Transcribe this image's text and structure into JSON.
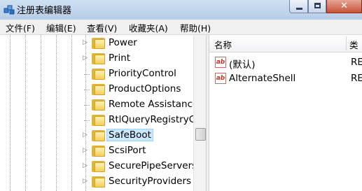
{
  "window": {
    "title": "注册表编辑器",
    "close_glyph": "✕"
  },
  "menu": [
    "文件(F)",
    "编辑(E)",
    "查看(V)",
    "收藏夹(A)",
    "帮助(H)"
  ],
  "tree": {
    "items": [
      {
        "label": "Power",
        "expandable": true,
        "selected": false
      },
      {
        "label": "Print",
        "expandable": true,
        "selected": false
      },
      {
        "label": "PriorityControl",
        "expandable": false,
        "selected": false
      },
      {
        "label": "ProductOptions",
        "expandable": false,
        "selected": false
      },
      {
        "label": "Remote Assistance",
        "expandable": false,
        "selected": false
      },
      {
        "label": "RtlQueryRegistryCo",
        "expandable": false,
        "selected": false
      },
      {
        "label": "SafeBoot",
        "expandable": true,
        "selected": true
      },
      {
        "label": "ScsiPort",
        "expandable": true,
        "selected": false
      },
      {
        "label": "SecurePipeServers",
        "expandable": true,
        "selected": false
      },
      {
        "label": "SecurityProviders",
        "expandable": true,
        "selected": false
      }
    ]
  },
  "list": {
    "columns": {
      "name": "名称",
      "type": "类"
    },
    "rows": [
      {
        "icon": "ab",
        "name": "(默认)",
        "type": "RE"
      },
      {
        "icon": "ab",
        "name": "AlternateShell",
        "type": "RE"
      }
    ]
  }
}
